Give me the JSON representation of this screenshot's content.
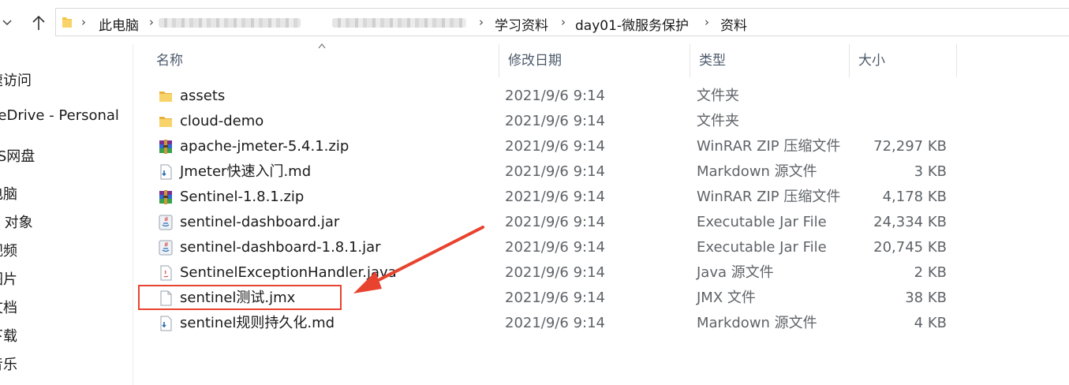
{
  "breadcrumb": {
    "root": "此电脑",
    "items": [
      "学习资料",
      "day01-微服务保护",
      "资料"
    ]
  },
  "sidebar": {
    "items": [
      {
        "label": "速访问",
        "icon": "star-icon"
      },
      {
        "label": "neDrive - Personal",
        "icon": "cloud-icon"
      },
      {
        "label": "PS网盘",
        "icon": "cloud-drive-icon"
      },
      {
        "label": "电脑",
        "icon": "computer-icon"
      },
      {
        "label": "D 对象",
        "icon": "cube-icon"
      },
      {
        "label": "视频",
        "icon": "video-icon"
      },
      {
        "label": "图片",
        "icon": "image-icon"
      },
      {
        "label": "文档",
        "icon": "document-icon"
      },
      {
        "label": "下载",
        "icon": "download-icon"
      },
      {
        "label": "音乐",
        "icon": "music-icon"
      }
    ]
  },
  "columns": {
    "name": "名称",
    "date": "修改日期",
    "type": "类型",
    "size": "大小"
  },
  "files": [
    {
      "name": "assets",
      "date": "2021/9/6 9:14",
      "type": "文件夹",
      "size": "",
      "icon": "folder-icon"
    },
    {
      "name": "cloud-demo",
      "date": "2021/9/6 9:14",
      "type": "文件夹",
      "size": "",
      "icon": "folder-icon"
    },
    {
      "name": "apache-jmeter-5.4.1.zip",
      "date": "2021/9/6 9:14",
      "type": "WinRAR ZIP 压缩文件",
      "size": "72,297 KB",
      "icon": "winrar-icon"
    },
    {
      "name": "Jmeter快速入门.md",
      "date": "2021/9/6 9:14",
      "type": "Markdown 源文件",
      "size": "3 KB",
      "icon": "markdown-file-icon"
    },
    {
      "name": "Sentinel-1.8.1.zip",
      "date": "2021/9/6 9:14",
      "type": "WinRAR ZIP 压缩文件",
      "size": "4,178 KB",
      "icon": "winrar-icon"
    },
    {
      "name": "sentinel-dashboard.jar",
      "date": "2021/9/6 9:14",
      "type": "Executable Jar File",
      "size": "24,334 KB",
      "icon": "java-jar-icon"
    },
    {
      "name": "sentinel-dashboard-1.8.1.jar",
      "date": "2021/9/6 9:14",
      "type": "Executable Jar File",
      "size": "20,745 KB",
      "icon": "java-jar-icon"
    },
    {
      "name": "SentinelExceptionHandler.java",
      "date": "2021/9/6 9:14",
      "type": "Java 源文件",
      "size": "2 KB",
      "icon": "java-file-icon"
    },
    {
      "name": "sentinel测试.jmx",
      "date": "2021/9/6 9:14",
      "type": "JMX 文件",
      "size": "38 KB",
      "icon": "blank-file-icon"
    },
    {
      "name": "sentinel规则持久化.md",
      "date": "2021/9/6 9:14",
      "type": "Markdown 源文件",
      "size": "4 KB",
      "icon": "markdown-file-icon"
    }
  ],
  "colors": {
    "annotation": "#e8432f",
    "folder": "#f4c542"
  }
}
